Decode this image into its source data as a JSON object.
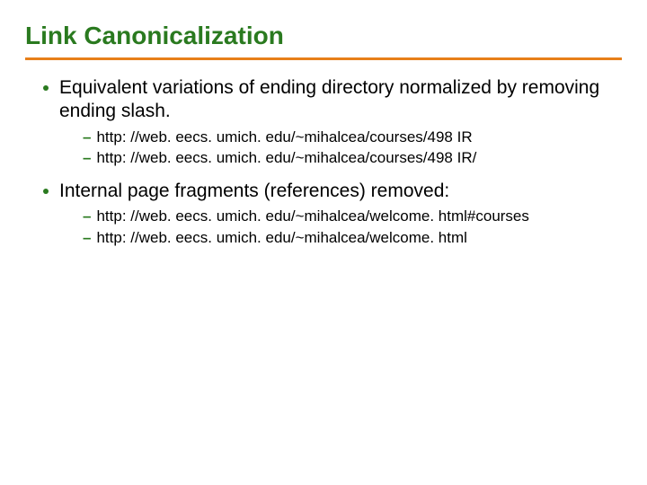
{
  "title": "Link Canonicalization",
  "bullets": [
    {
      "text": "Equivalent variations of ending directory normalized by removing ending slash.",
      "subs": [
        "http: //web. eecs. umich. edu/~mihalcea/courses/498 IR",
        "http: //web. eecs. umich. edu/~mihalcea/courses/498 IR/"
      ]
    },
    {
      "text": "Internal page fragments (references) removed:",
      "subs": [
        "http: //web. eecs. umich. edu/~mihalcea/welcome. html#courses",
        "http: //web. eecs. umich. edu/~mihalcea/welcome. html"
      ]
    }
  ]
}
